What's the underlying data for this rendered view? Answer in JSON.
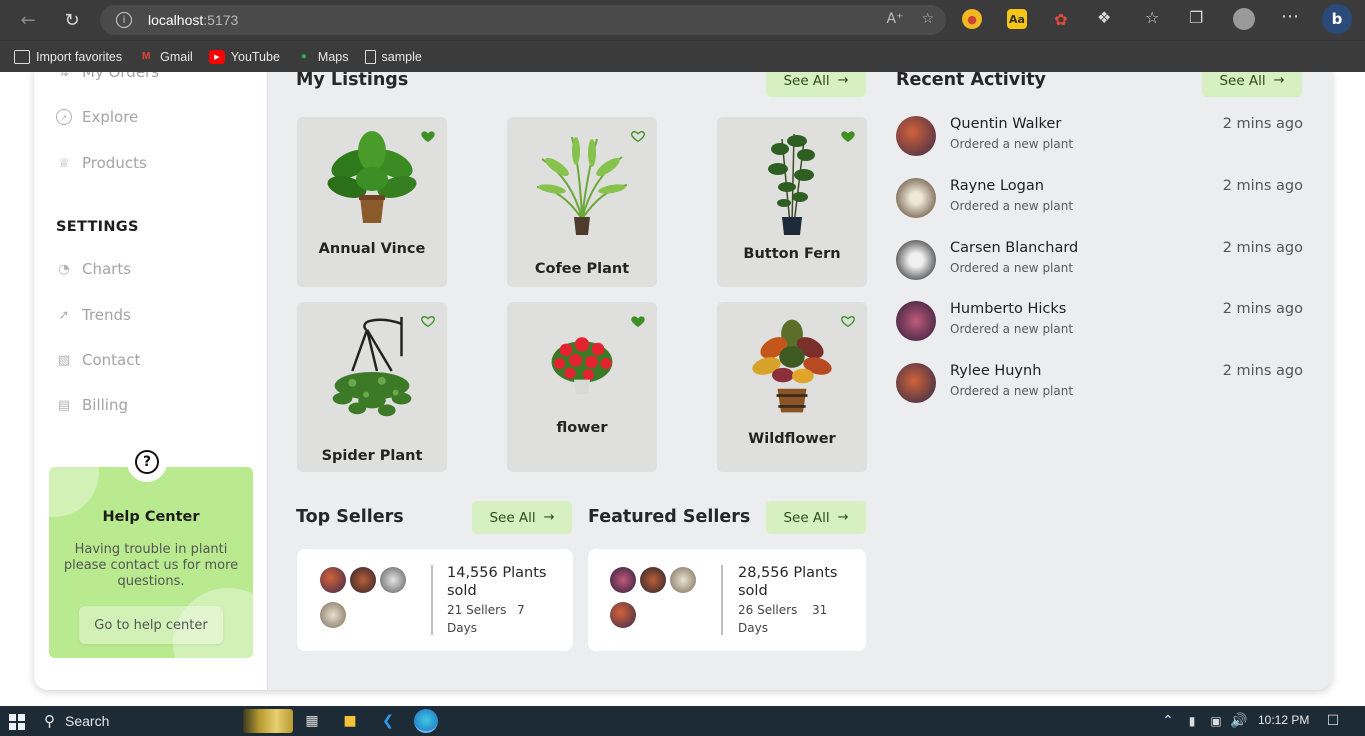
{
  "browser": {
    "url_host": "localhost",
    "url_port": ":5173",
    "favorites": [
      {
        "label": "Import favorites",
        "icon": "import-icon"
      },
      {
        "label": "Gmail",
        "icon": "gmail-icon"
      },
      {
        "label": "YouTube",
        "icon": "youtube-icon"
      },
      {
        "label": "Maps",
        "icon": "maps-icon"
      },
      {
        "label": "sample",
        "icon": "page-icon"
      }
    ]
  },
  "sidebar": {
    "items_top": [
      {
        "label": "My Orders",
        "icon": "orders-icon"
      },
      {
        "label": "Explore",
        "icon": "compass-icon"
      },
      {
        "label": "Products",
        "icon": "trophy-icon"
      }
    ],
    "settings_heading": "SETTINGS",
    "items_settings": [
      {
        "label": "Charts",
        "icon": "pie-chart-icon"
      },
      {
        "label": "Trends",
        "icon": "trend-icon"
      },
      {
        "label": "Contact",
        "icon": "contact-icon"
      },
      {
        "label": "Billing",
        "icon": "billing-icon"
      }
    ],
    "help": {
      "title": "Help Center",
      "text": "Having trouble in planti please contact us for more questions.",
      "button": "Go to help center"
    }
  },
  "listings": {
    "title": "My Listings",
    "see_all": "See All",
    "items": [
      {
        "name": "Annual Vince",
        "favorited": true
      },
      {
        "name": "Cofee Plant",
        "favorited": false
      },
      {
        "name": "Button Fern",
        "favorited": true
      },
      {
        "name": "Spider Plant",
        "favorited": false
      },
      {
        "name": "flower",
        "favorited": true
      },
      {
        "name": "Wildflower",
        "favorited": false
      }
    ]
  },
  "top_sellers": {
    "title": "Top Sellers",
    "see_all": "See All",
    "plants_sold": "14,556 Plants sold",
    "sellers": "21 Sellers",
    "days": "7 Days"
  },
  "featured_sellers": {
    "title": "Featured Sellers",
    "see_all": "See All",
    "plants_sold": "28,556 Plants sold",
    "sellers": "26 Sellers",
    "days": "31 Days"
  },
  "activity": {
    "title": "Recent Activity",
    "see_all": "See All",
    "items": [
      {
        "name": "Quentin Walker",
        "desc": "Ordered a new plant",
        "time": "2 mins ago"
      },
      {
        "name": "Rayne Logan",
        "desc": "Ordered a new plant",
        "time": "2 mins ago"
      },
      {
        "name": "Carsen Blanchard",
        "desc": "Ordered a new plant",
        "time": "2 mins ago"
      },
      {
        "name": "Humberto Hicks",
        "desc": "Ordered a new plant",
        "time": "2 mins ago"
      },
      {
        "name": "Rylee Huynh",
        "desc": "Ordered a new plant",
        "time": "2 mins ago"
      }
    ]
  },
  "taskbar": {
    "search": "Search",
    "time": "10:12 PM"
  },
  "colors": {
    "accent_green": "#3f8f25",
    "button_green_bg": "#d6f0c2",
    "help_card_bg": "#b9ea8f"
  }
}
